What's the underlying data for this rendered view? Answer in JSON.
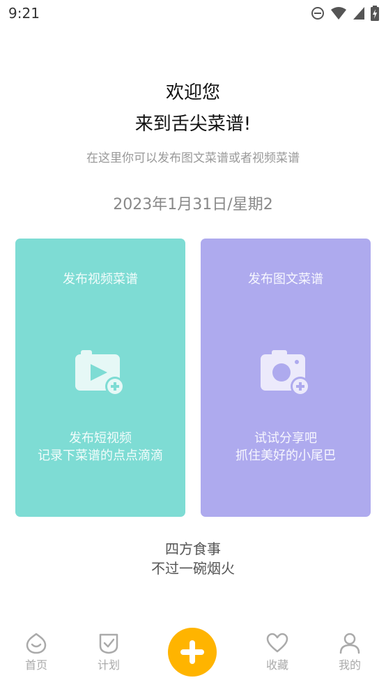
{
  "status_bar": {
    "time": "9:21",
    "icons": [
      "do-not-disturb-icon",
      "wifi-icon",
      "cellular-signal-icon",
      "battery-charging-icon"
    ]
  },
  "header": {
    "welcome_line1": "欢迎您",
    "welcome_line2": "来到舌尖菜谱!",
    "subtitle": "在这里你可以发布图文菜谱或者视频菜谱",
    "date": "2023年1月31日/星期2"
  },
  "cards": {
    "video": {
      "title": "发布视频菜谱",
      "line1": "发布短视频",
      "line2": "记录下菜谱的点点滴滴",
      "icon": "video-add-icon",
      "color": "#7edcd4"
    },
    "photo": {
      "title": "发布图文菜谱",
      "line1": "试试分享吧",
      "line2": "抓住美好的小尾巴",
      "icon": "camera-add-icon",
      "color": "#aeaaee"
    }
  },
  "slogan": {
    "line1": "四方食事",
    "line2": "不过一碗烟火"
  },
  "bottom_nav": {
    "home": "首页",
    "plan": "计划",
    "favorites": "收藏",
    "mine": "我的",
    "fab_icon": "plus-icon",
    "fab_color": "#ffb400"
  }
}
